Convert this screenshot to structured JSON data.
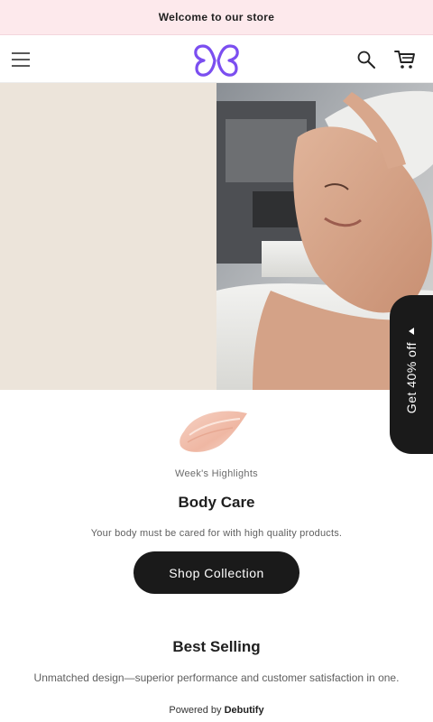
{
  "announcement": {
    "text": "Welcome to our store"
  },
  "header": {
    "menu_icon": "hamburger-menu-icon",
    "logo_icon": "butterfly-logo-icon",
    "search_icon": "search-icon",
    "cart_icon": "shopping-cart-icon",
    "brand_color": "#7b4ef0"
  },
  "hero": {
    "image_subject": "spa facial treatment photo"
  },
  "highlight": {
    "eyebrow": "Week's Highlights",
    "title": "Body Care",
    "subtitle": "Your body must be cared for with high quality products.",
    "cta_label": "Shop Collection"
  },
  "best_selling": {
    "title": "Best Selling",
    "description": "Unmatched design—superior performance and customer satisfaction in one."
  },
  "footer": {
    "powered_prefix": "Powered by",
    "powered_brand": "Debutify"
  },
  "promo_tab": {
    "label": "Get 40% off",
    "arrow_icon": "caret-left-icon"
  }
}
